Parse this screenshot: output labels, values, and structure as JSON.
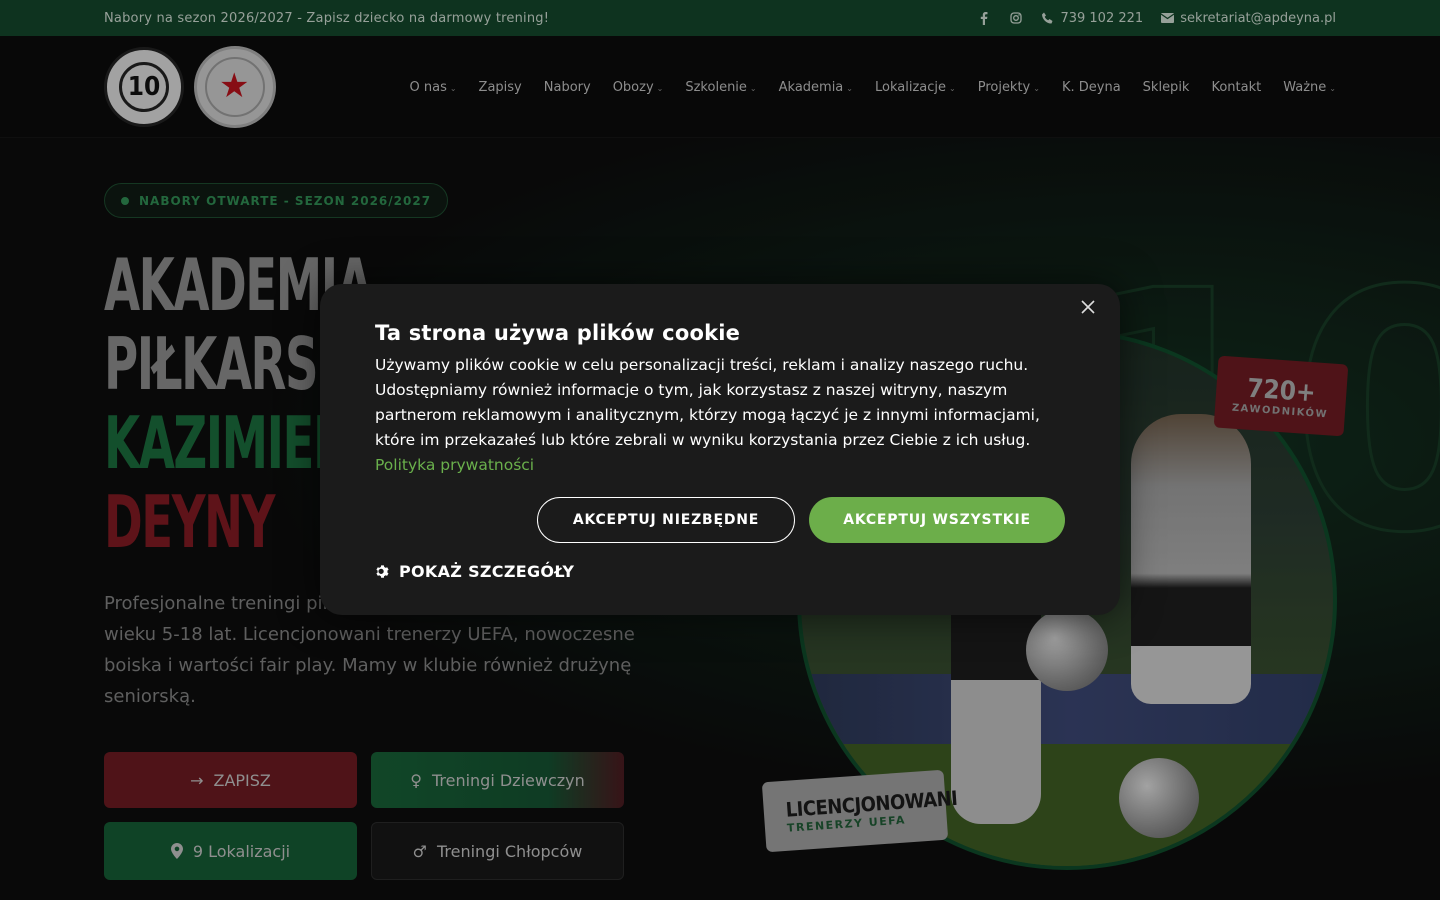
{
  "topbar": {
    "promo": "Nabory na sezon 2026/2027 - Zapisz dziecko na darmowy trening!",
    "phone": "739 102 221",
    "email": "sekretariat@apdeyna.pl"
  },
  "header": {
    "logo1_number": "10",
    "nav": [
      {
        "label": "O nas",
        "dropdown": true
      },
      {
        "label": "Zapisy",
        "dropdown": false
      },
      {
        "label": "Nabory",
        "dropdown": false
      },
      {
        "label": "Obozy",
        "dropdown": true
      },
      {
        "label": "Szkolenie",
        "dropdown": true
      },
      {
        "label": "Akademia",
        "dropdown": true
      },
      {
        "label": "Lokalizacje",
        "dropdown": true
      },
      {
        "label": "Projekty",
        "dropdown": true
      },
      {
        "label": "K. Deyna",
        "dropdown": false
      },
      {
        "label": "Sklepik",
        "dropdown": false
      },
      {
        "label": "Kontakt",
        "dropdown": false
      },
      {
        "label": "Ważne",
        "dropdown": true
      }
    ]
  },
  "hero": {
    "badge": "NABORY OTWARTE - SEZON 2026/2027",
    "title_line1": "AKADEMIA",
    "title_line2": "PIŁKARSKA",
    "title_line3": "KAZIMIERZA",
    "title_line4": "DEYNY",
    "description": "Profesjonalne treningi piłkarskie dla dzieci i młodzieży w wieku 5-18 lat. Licencjonowani trenerzy UEFA, nowoczesne boiska i wartości fair play. Mamy w klubie również drużynę seniorską.",
    "btn_signup": "ZAPISZ",
    "btn_girls": "Treningi Dziewczyn",
    "btn_locations": "9 Lokalizacji",
    "btn_boys": "Treningi Chłopców",
    "stat_number": "720+",
    "stat_label": "ZAWODNIKÓW",
    "lic_title": "LICENCJONOWANI",
    "lic_sub": "TRENERZY UEFA",
    "bg_number": "10"
  },
  "cookie": {
    "title": "Ta strona używa plików cookie",
    "text": "Używamy plików cookie w celu personalizacji treści, reklam i analizy naszego ruchu. Udostępniamy również informacje o tym, jak korzystasz z naszej witryny, naszym partnerom reklamowym i analitycznym, którzy mogą łączyć je z innymi informacjami, które im przekazałeś lub które zebrali w wyniku korzystania przez Ciebie z ich usług.",
    "policy_link": "Polityka prywatności",
    "btn_essential": "AKCEPTUJ NIEZBĘDNE",
    "btn_all": "AKCEPTUJ WSZYSTKIE",
    "details": "POKAŻ SZCZEGÓŁY",
    "accent_color": "#6cae4a"
  }
}
